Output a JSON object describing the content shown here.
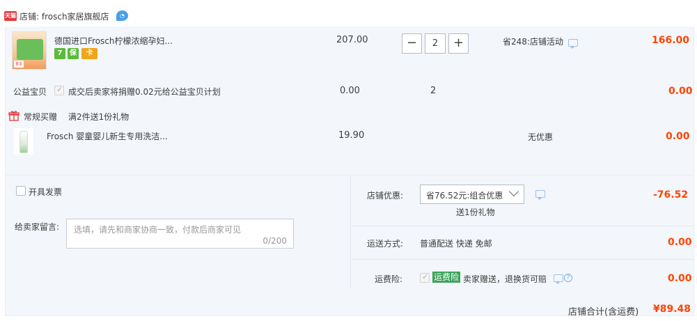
{
  "shop": {
    "badge": "天猫",
    "label": "店铺: frosch家居旗舰店",
    "wang_icon": "aliwangwang-icon"
  },
  "items": [
    {
      "title": "德国进口Frosch柠檬浓缩孕妇...",
      "unit_price": "207.00",
      "quantity": "2",
      "promo": "省248:店铺活动",
      "subtotal": "166.00",
      "badges": [
        "7",
        "保",
        "卡"
      ]
    }
  ],
  "charity": {
    "label": "公益宝贝",
    "text": "成交后卖家将捐赠0.02元给公益宝贝计划",
    "price": "0.00",
    "quantity": "2",
    "subtotal": "0.00"
  },
  "gift": {
    "label": "常规买赠",
    "rule": "满2件送1份礼物",
    "title": "Frosch 婴童婴儿新生专用洗洁...",
    "price": "19.90",
    "promo": "无优惠",
    "subtotal": "0.00"
  },
  "invoice": {
    "label": "开具发票"
  },
  "message": {
    "label": "给卖家留言:",
    "placeholder": "选填，请先和商家协商一致，付款后商家可见",
    "counter": "0/200"
  },
  "discount": {
    "label": "店铺优惠:",
    "selected": "省76.52元:组合优惠",
    "note": "送1份礼物",
    "amount": "-76.52"
  },
  "shipping": {
    "label": "运送方式:",
    "value": "普通配送 快递 免邮",
    "amount": "0.00"
  },
  "insurance": {
    "label": "运费险:",
    "tag": "运费险",
    "text": "卖家赠送，退换货可赔",
    "amount": "0.00"
  },
  "total": {
    "label": "店铺合计(含运费)",
    "amount": "¥89.48"
  },
  "colors": {
    "accent_red": "#ff4400",
    "panel_bg": "#f3f6fb",
    "tag_green": "#3aa35a"
  }
}
